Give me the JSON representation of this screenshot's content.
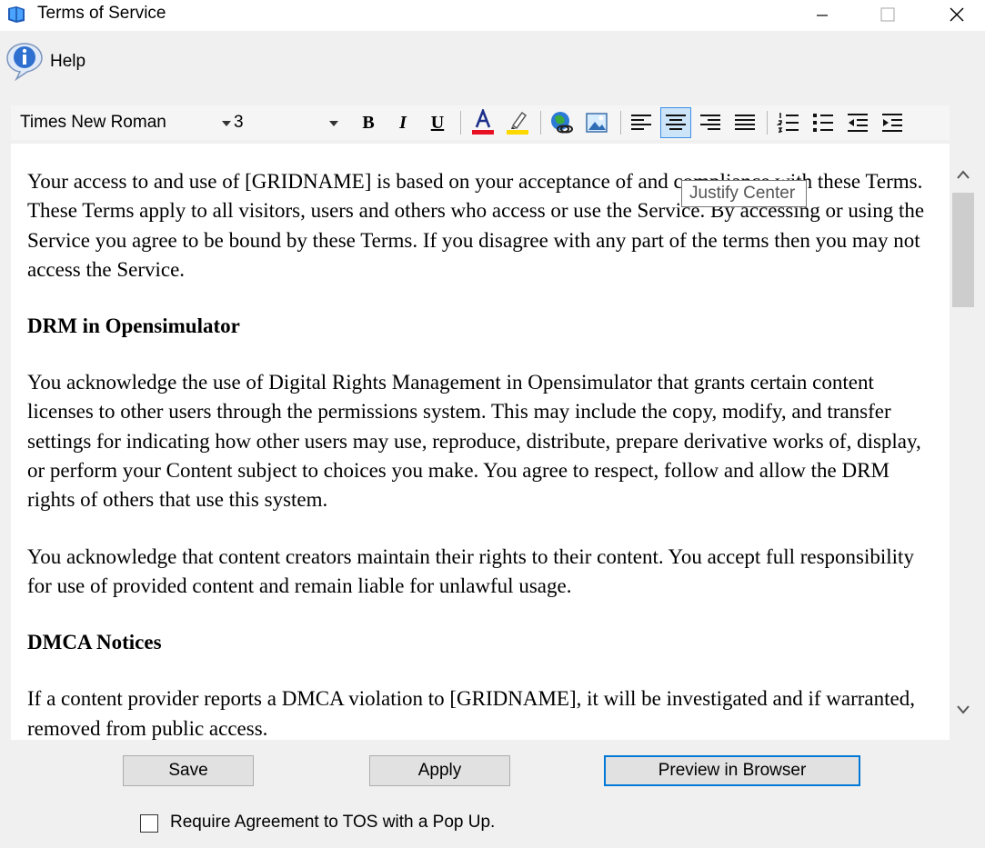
{
  "window": {
    "title": "Terms of Service"
  },
  "menu": {
    "help_label": "Help"
  },
  "toolbar": {
    "font_family": "Times New Roman",
    "font_size": "3",
    "bold": "B",
    "italic": "I",
    "underline": "U",
    "active_button": "justify-center",
    "tooltip": "Justify Center"
  },
  "document": {
    "intro": "Your access to and use of [GRIDNAME] is based on your acceptance of and compliance with these Terms. These Terms apply to all visitors, users and others who access or use the Service. By accessing or using the Service you agree to be bound by these Terms. If you disagree with any part of the terms then you may not access the Service.",
    "heading_drm": "DRM in Opensimulator",
    "drm_p1": "You acknowledge the use of Digital Rights Management in Opensimulator that grants certain content licenses to other users through the permissions system. This may include the copy, modify, and transfer settings for indicating how other users may use, reproduce, distribute, prepare derivative works of, display, or perform your Content subject to choices you make. You agree to respect, follow and allow the DRM rights of others that use this system.",
    "drm_p2": "You acknowledge that content creators maintain their rights to their content. You accept full responsibility for use of provided content and remain liable for unlawful usage.",
    "heading_dmca": "DMCA Notices",
    "dmca_p1": "If a content provider reports a DMCA violation to [GRIDNAME], it will be investigated and if warranted, removed from public access."
  },
  "buttons": {
    "save": "Save",
    "apply": "Apply",
    "preview": "Preview in Browser"
  },
  "options": {
    "require_popup_label": "Require Agreement to TOS with a Pop Up.",
    "require_popup_checked": false
  },
  "colors": {
    "font_color_bar": "#e81123",
    "highlight_color_bar": "#ffd800",
    "accent": "#0078d7"
  }
}
